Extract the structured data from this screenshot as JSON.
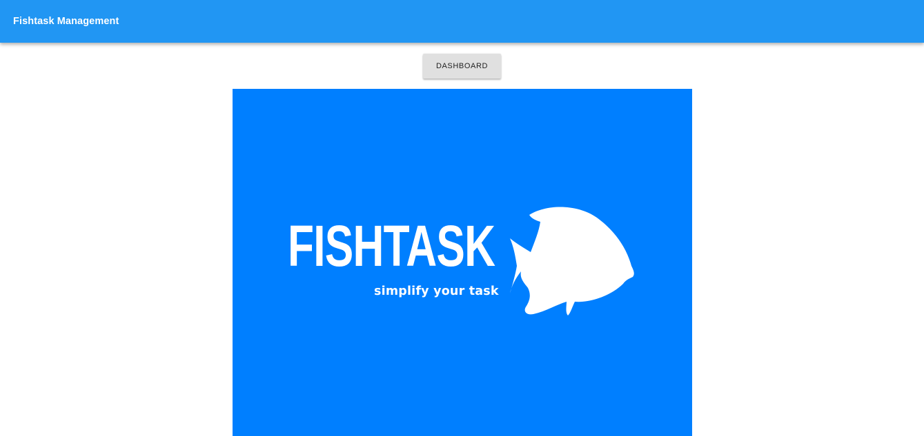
{
  "app_bar": {
    "title": "Fishtask Management",
    "color": "#2196f3"
  },
  "nav": {
    "dashboard_label": "Dashboard"
  },
  "banner": {
    "background": "#007fff",
    "wordmark": "FISHTASK",
    "tagline": "simplify your task",
    "logo_icon": "fish-icon"
  }
}
